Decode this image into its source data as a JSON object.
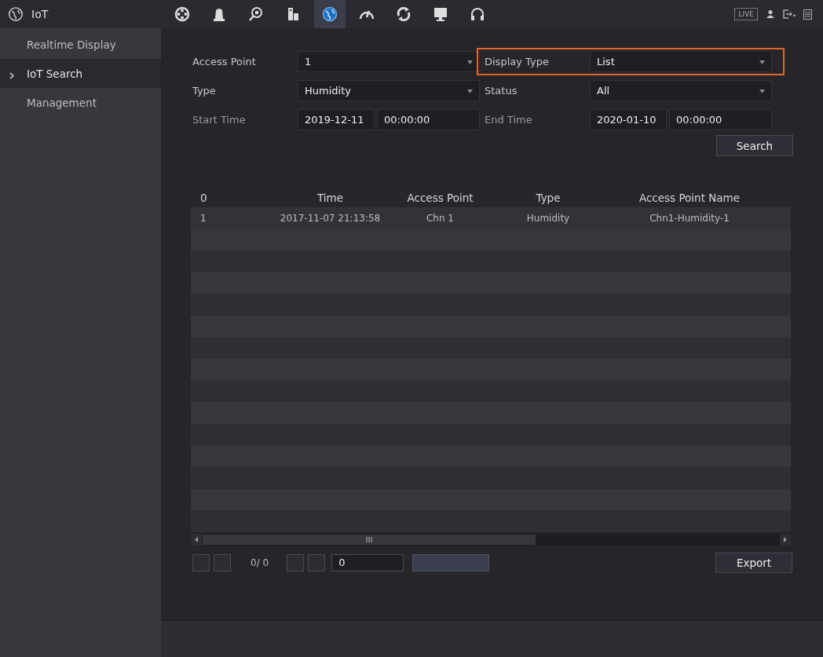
{
  "window": {
    "title": "IoT"
  },
  "toolbar": [
    {
      "kind": "reel",
      "selected": false
    },
    {
      "kind": "bell",
      "selected": false
    },
    {
      "kind": "search",
      "selected": false
    },
    {
      "kind": "network",
      "selected": false
    },
    {
      "kind": "globe",
      "selected": true
    },
    {
      "kind": "gauge",
      "selected": false
    },
    {
      "kind": "refresh",
      "selected": false
    },
    {
      "kind": "monitor",
      "selected": false
    },
    {
      "kind": "headset",
      "selected": false
    }
  ],
  "live_badge": "LIVE",
  "sidebar": {
    "items": [
      {
        "label": "Realtime Display",
        "selected": false
      },
      {
        "label": "IoT Search",
        "selected": true
      },
      {
        "label": "Management",
        "selected": false
      }
    ]
  },
  "filters": [
    {
      "label": "Access Point",
      "kind": "dropdown",
      "value": "1",
      "highlighted": false
    },
    {
      "label": "Display Type",
      "kind": "dropdown",
      "value": "List",
      "highlighted": true
    },
    {
      "label": "Type",
      "kind": "dropdown",
      "value": "Humidity",
      "highlighted": false
    },
    {
      "label": "Status",
      "kind": "dropdown",
      "value": "All",
      "highlighted": false
    },
    {
      "label": "Start Time",
      "kind": "datetime",
      "date": "2019-12-11",
      "time": "00:00:00",
      "highlighted": false
    },
    {
      "label": "End Time",
      "kind": "datetime",
      "date": "2020-01-10",
      "time": "00:00:00",
      "highlighted": false
    }
  ],
  "search_button": "Search",
  "table": {
    "columns": [
      "0",
      "Time",
      "Access Point",
      "Type",
      "Access Point Name"
    ],
    "rows": [
      [
        "1",
        "2017-11-07 21:13:58",
        "Chn 1",
        "Humidity",
        "Chn1-Humidity-1"
      ]
    ]
  },
  "pager": {
    "page": "0/ 0",
    "page_input": "0"
  },
  "export_button": "Export"
}
